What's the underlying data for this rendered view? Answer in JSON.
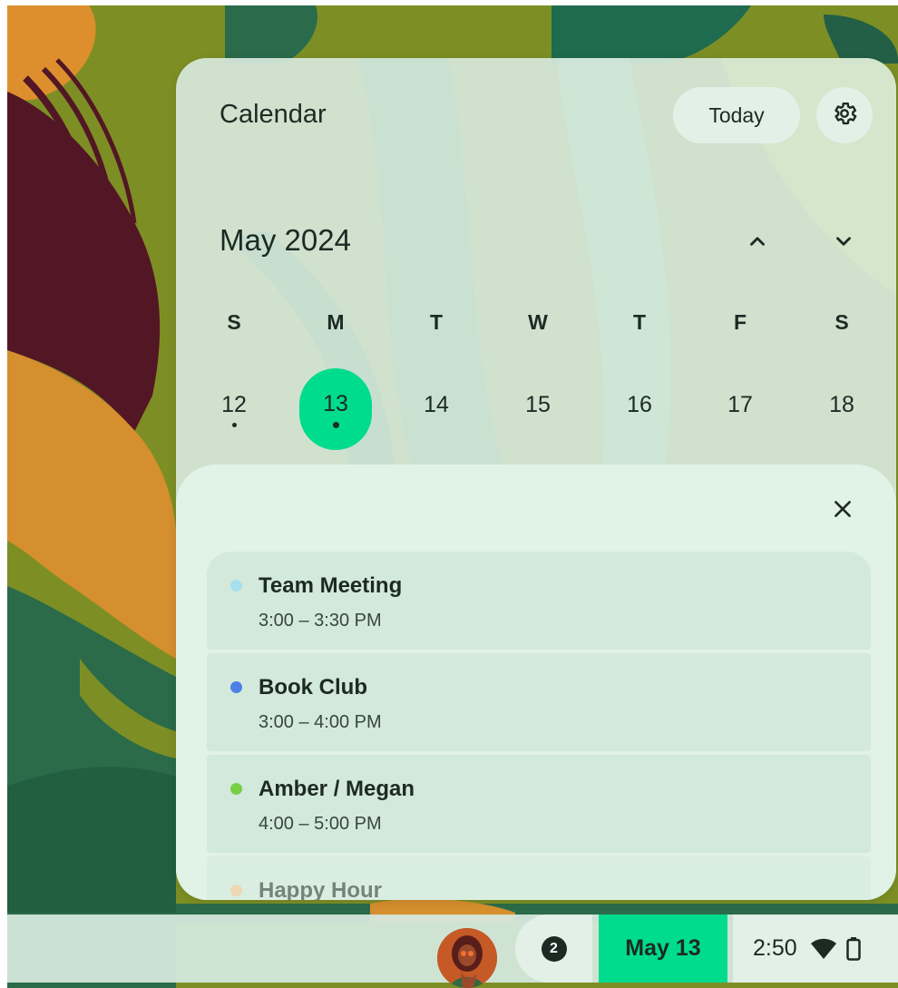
{
  "calendar": {
    "title": "Calendar",
    "today_label": "Today",
    "settings_icon": "gear-icon",
    "month_label": "May 2024",
    "prev_icon": "chevron-up-icon",
    "next_icon": "chevron-down-icon",
    "weekdays": [
      "S",
      "M",
      "T",
      "W",
      "T",
      "F",
      "S"
    ],
    "days": [
      {
        "label": "12",
        "has_events": true,
        "selected": false
      },
      {
        "label": "13",
        "has_events": true,
        "selected": true
      },
      {
        "label": "14",
        "has_events": false,
        "selected": false
      },
      {
        "label": "15",
        "has_events": false,
        "selected": false
      },
      {
        "label": "16",
        "has_events": false,
        "selected": false
      },
      {
        "label": "17",
        "has_events": false,
        "selected": false
      },
      {
        "label": "18",
        "has_events": false,
        "selected": false
      }
    ],
    "accent_color": "#00dc8e"
  },
  "events_sheet": {
    "close_icon": "close-icon",
    "events": [
      {
        "title": "Team Meeting",
        "time": "3:00 – 3:30 PM",
        "color": "#a6e0ee"
      },
      {
        "title": "Book Club",
        "time": "3:00 – 4:00 PM",
        "color": "#4d7fe6"
      },
      {
        "title": "Amber / Megan",
        "time": "4:00 – 5:00 PM",
        "color": "#76cf45"
      },
      {
        "title": "Happy Hour",
        "time": "",
        "color": "#f5c48a"
      }
    ]
  },
  "shelf": {
    "avatar_icon": "user-avatar",
    "notification_count": "2",
    "date_label": "May 13",
    "time_label": "2:50",
    "wifi_icon": "wifi-icon",
    "battery_icon": "battery-icon"
  }
}
